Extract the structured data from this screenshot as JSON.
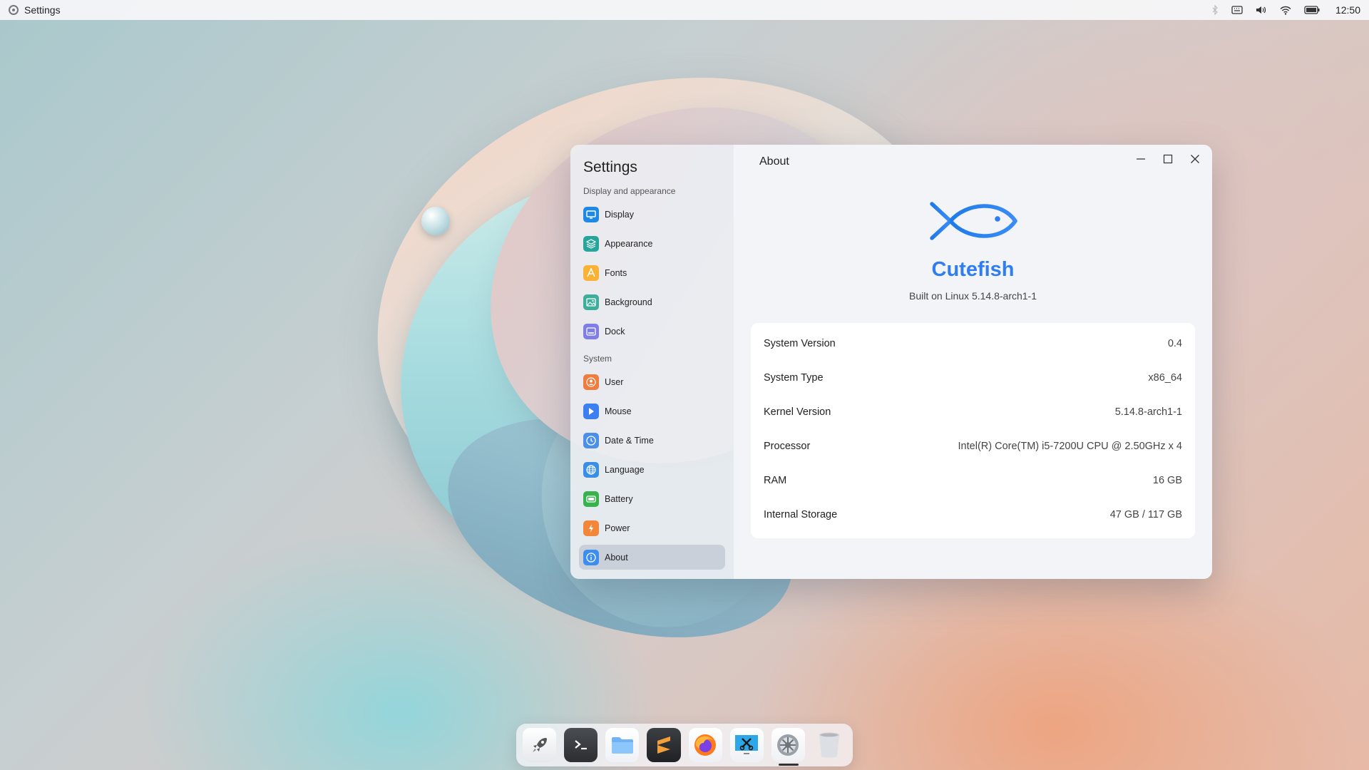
{
  "topbar": {
    "app_name": "Settings",
    "time": "12:50",
    "tray_icons": [
      "bluetooth-icon",
      "keyboard-icon",
      "volume-icon",
      "wifi-icon",
      "battery-icon"
    ]
  },
  "window": {
    "sidebar": {
      "title": "Settings",
      "section_display": "Display and appearance",
      "section_system": "System",
      "display_items": [
        {
          "label": "Display",
          "icon": "display-icon",
          "color": "#1e88e5"
        },
        {
          "label": "Appearance",
          "icon": "appearance-icon",
          "color": "#26a69a"
        },
        {
          "label": "Fonts",
          "icon": "fonts-icon",
          "color": "#f9b233"
        },
        {
          "label": "Background",
          "icon": "background-icon",
          "color": "#3cae9a"
        },
        {
          "label": "Dock",
          "icon": "dock-icon",
          "color": "#7e7ee6"
        }
      ],
      "system_items": [
        {
          "label": "User",
          "icon": "user-icon",
          "color": "#f07c3e"
        },
        {
          "label": "Mouse",
          "icon": "mouse-icon",
          "color": "#3b7ff0"
        },
        {
          "label": "Date & Time",
          "icon": "clock-icon",
          "color": "#4a8fe8"
        },
        {
          "label": "Language",
          "icon": "globe-icon",
          "color": "#3a8ee6"
        },
        {
          "label": "Battery",
          "icon": "battery-icon",
          "color": "#37b24d"
        },
        {
          "label": "Power",
          "icon": "power-icon",
          "color": "#f2873a"
        },
        {
          "label": "About",
          "icon": "info-icon",
          "color": "#3b8df0",
          "active": true
        }
      ]
    },
    "main": {
      "title": "About",
      "brand": "Cutefish",
      "built_on": "Built on Linux 5.14.8-arch1-1",
      "brand_color": "#2f7df0",
      "info": [
        {
          "label": "System Version",
          "value": "0.4"
        },
        {
          "label": "System Type",
          "value": "x86_64"
        },
        {
          "label": "Kernel Version",
          "value": "5.14.8-arch1-1"
        },
        {
          "label": "Processor",
          "value": "Intel(R) Core(TM) i5-7200U CPU @ 2.50GHz x 4"
        },
        {
          "label": "RAM",
          "value": "16 GB"
        },
        {
          "label": "Internal Storage",
          "value": "47 GB / 117 GB"
        }
      ]
    }
  },
  "dock": {
    "items": [
      {
        "name": "launcher-icon"
      },
      {
        "name": "terminal-icon"
      },
      {
        "name": "files-icon"
      },
      {
        "name": "sublime-text-icon"
      },
      {
        "name": "firefox-icon"
      },
      {
        "name": "screenshot-tool-icon"
      },
      {
        "name": "settings-icon",
        "running": true
      },
      {
        "name": "trash-icon"
      }
    ]
  }
}
